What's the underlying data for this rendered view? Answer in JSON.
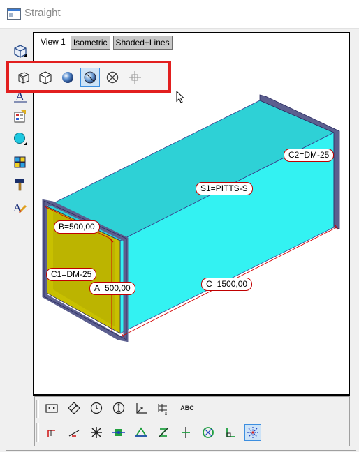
{
  "window": {
    "title": "Straight"
  },
  "view_tabs": [
    {
      "label": "View 1"
    },
    {
      "label": "Isometric"
    },
    {
      "label": "Shaded+Lines"
    }
  ],
  "left_toolbar": {
    "icons": [
      "view-cube-icon",
      "shade-sphere-icon",
      "text-a-icon",
      "properties-icon",
      "circle-shape-icon",
      "color-grid-icon",
      "hammer-icon",
      "text-edit-icon"
    ]
  },
  "shading_popup": {
    "highlight_color": "#e21f1f",
    "options": [
      "wire-perspective-icon",
      "hidden-line-cube-icon",
      "shaded-sphere-icon",
      "shaded-lines-sphere-icon",
      "xray-icon",
      "crosshair-move-icon"
    ],
    "selected": "shaded-lines-sphere-icon"
  },
  "drawing": {
    "colors": {
      "duct": "#33f2f2",
      "duct_top": "#2ed1d6",
      "end_face": "#c8c000",
      "flange": "#5c5f8f",
      "dim_line": "#d00000"
    },
    "labels": {
      "s1": "S1=PITTS-S",
      "c2": "C2=DM-25",
      "b": "B=500,00",
      "c1": "C1=DM-25",
      "a": "A=500,00",
      "c": "C=1500,00"
    }
  },
  "bottom_toolbar": {
    "row1": [
      "zoom-extents-icon",
      "zoom-window-icon",
      "rotate-icon",
      "pan-icon",
      "axis-icon",
      "axis-grid-icon"
    ],
    "row1_text": "ABC",
    "row2": [
      "snap-end-icon",
      "snap-line-icon",
      "snap-star-icon",
      "snap-center-icon",
      "snap-triangle-icon",
      "snap-intersect-icon",
      "snap-perpendicular-icon",
      "snap-circle-icon",
      "snap-corner-icon",
      "snap-grid-icon"
    ],
    "row2_selected": "snap-grid-icon"
  }
}
